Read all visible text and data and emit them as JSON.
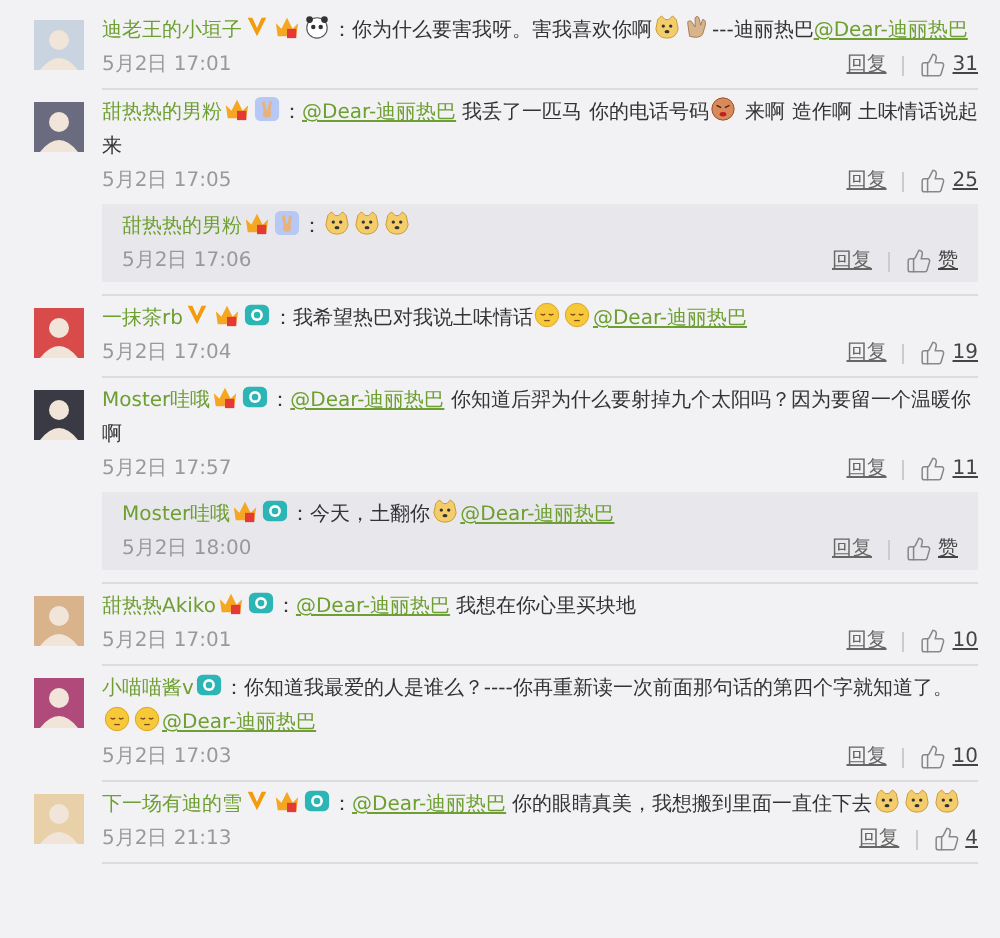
{
  "comments": [
    {
      "name": "迪老王的小垣子",
      "badges": [
        {
          "kind": "verified"
        },
        {
          "kind": "crown"
        },
        {
          "kind": "panda"
        }
      ],
      "content": [
        {
          "kind": "text",
          "text": "：你为什么要害我呀。害我喜欢你啊"
        },
        {
          "kind": "doge"
        },
        {
          "kind": "clap"
        },
        {
          "kind": "text",
          "text": "---迪丽热巴"
        },
        {
          "kind": "mention",
          "text": "@Dear-迪丽热巴"
        }
      ],
      "time": "5月2日 17:01",
      "reply": "回复",
      "likes": "31"
    },
    {
      "name": "甜热热的男粉",
      "badges": [
        {
          "kind": "crown"
        },
        {
          "kind": "peace"
        }
      ],
      "content": [
        {
          "kind": "text",
          "text": "："
        },
        {
          "kind": "mention",
          "text": "@Dear-迪丽热巴"
        },
        {
          "kind": "text",
          "text": " 我丢了一匹马 你的电话号码"
        },
        {
          "kind": "angry"
        },
        {
          "kind": "text",
          "text": " 来啊 造作啊 土味情话说起来"
        }
      ],
      "time": "5月2日 17:05",
      "reply": "回复",
      "likes": "25",
      "replies": [
        {
          "name": "甜热热的男粉",
          "badges": [
            {
              "kind": "crown"
            },
            {
              "kind": "peace"
            }
          ],
          "content": [
            {
              "kind": "text",
              "text": "："
            },
            {
              "kind": "doge"
            },
            {
              "kind": "doge"
            },
            {
              "kind": "doge"
            }
          ],
          "time": "5月2日 17:06",
          "reply": "回复",
          "likes": "赞"
        }
      ]
    },
    {
      "name": "一抹茶rb",
      "badges": [
        {
          "kind": "verified"
        },
        {
          "kind": "crown"
        },
        {
          "kind": "camera"
        }
      ],
      "content": [
        {
          "kind": "text",
          "text": "：我希望热巴对我说土味情话"
        },
        {
          "kind": "sleepy"
        },
        {
          "kind": "sleepy"
        },
        {
          "kind": "mention",
          "text": "@Dear-迪丽热巴"
        }
      ],
      "time": "5月2日 17:04",
      "reply": "回复",
      "likes": "19"
    },
    {
      "name": "Moster哇哦",
      "badges": [
        {
          "kind": "crown"
        },
        {
          "kind": "camera"
        }
      ],
      "content": [
        {
          "kind": "text",
          "text": "："
        },
        {
          "kind": "mention",
          "text": "@Dear-迪丽热巴"
        },
        {
          "kind": "text",
          "text": " 你知道后羿为什么要射掉九个太阳吗？因为要留一个温暖你啊"
        }
      ],
      "time": "5月2日 17:57",
      "reply": "回复",
      "likes": "11",
      "replies": [
        {
          "name": "Moster哇哦",
          "badges": [
            {
              "kind": "crown"
            },
            {
              "kind": "camera"
            }
          ],
          "content": [
            {
              "kind": "text",
              "text": "：今天，土翻你"
            },
            {
              "kind": "doge"
            },
            {
              "kind": "mention",
              "text": "@Dear-迪丽热巴"
            }
          ],
          "time": "5月2日 18:00",
          "reply": "回复",
          "likes": "赞"
        }
      ]
    },
    {
      "name": "甜热热Akiko",
      "badges": [
        {
          "kind": "crown"
        },
        {
          "kind": "camera"
        }
      ],
      "content": [
        {
          "kind": "text",
          "text": "："
        },
        {
          "kind": "mention",
          "text": "@Dear-迪丽热巴"
        },
        {
          "kind": "text",
          "text": " 我想在你心里买块地"
        }
      ],
      "time": "5月2日 17:01",
      "reply": "回复",
      "likes": "10"
    },
    {
      "name": "小喵喵酱v",
      "badges": [
        {
          "kind": "camera"
        }
      ],
      "content": [
        {
          "kind": "text",
          "text": "：你知道我最爱的人是谁么？----你再重新读一次前面那句话的第四个字就知道了。"
        },
        {
          "kind": "sleepy"
        },
        {
          "kind": "sleepy"
        },
        {
          "kind": "mention",
          "text": "@Dear-迪丽热巴"
        }
      ],
      "time": "5月2日 17:03",
      "reply": "回复",
      "likes": "10"
    },
    {
      "name": "下一场有迪的雪",
      "badges": [
        {
          "kind": "verified"
        },
        {
          "kind": "crown"
        },
        {
          "kind": "camera"
        }
      ],
      "content": [
        {
          "kind": "text",
          "text": "："
        },
        {
          "kind": "mention",
          "text": "@Dear-迪丽热巴"
        },
        {
          "kind": "text",
          "text": " 你的眼睛真美，我想搬到里面一直住下去"
        },
        {
          "kind": "doge"
        },
        {
          "kind": "doge"
        },
        {
          "kind": "doge"
        }
      ],
      "time": "5月2日 21:13",
      "reply": "回复",
      "likes": "4"
    }
  ]
}
